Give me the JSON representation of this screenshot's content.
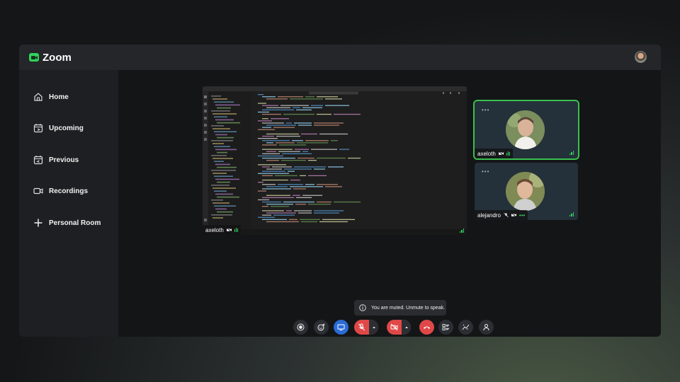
{
  "app": {
    "name": "Zoom"
  },
  "nav": [
    {
      "id": "home",
      "label": "Home",
      "icon": "home-icon"
    },
    {
      "id": "upcoming",
      "label": "Upcoming",
      "icon": "calendar-forward-icon"
    },
    {
      "id": "previous",
      "label": "Previous",
      "icon": "calendar-back-icon"
    },
    {
      "id": "recordings",
      "label": "Recordings",
      "icon": "video-camera-icon"
    },
    {
      "id": "personal-room",
      "label": "Personal Room",
      "icon": "plus-icon"
    }
  ],
  "share": {
    "presenter": "axeloth"
  },
  "participants": [
    {
      "name": "axeloth",
      "speaking": true
    },
    {
      "name": "alejandro",
      "speaking": false
    }
  ],
  "toast": {
    "message": "You are muted. Unmute to speak."
  },
  "colors": {
    "accent": "#2fd35a",
    "danger": "#e04848",
    "share_blue": "#2a6cd6",
    "panel": "#1d1f22"
  },
  "controls": [
    "record-icon",
    "reaction-icon",
    "share-screen-icon",
    "microphone-muted-icon",
    "camera-off-icon",
    "hang-up-icon",
    "participants-list-icon",
    "effects-icon",
    "person-icon"
  ]
}
